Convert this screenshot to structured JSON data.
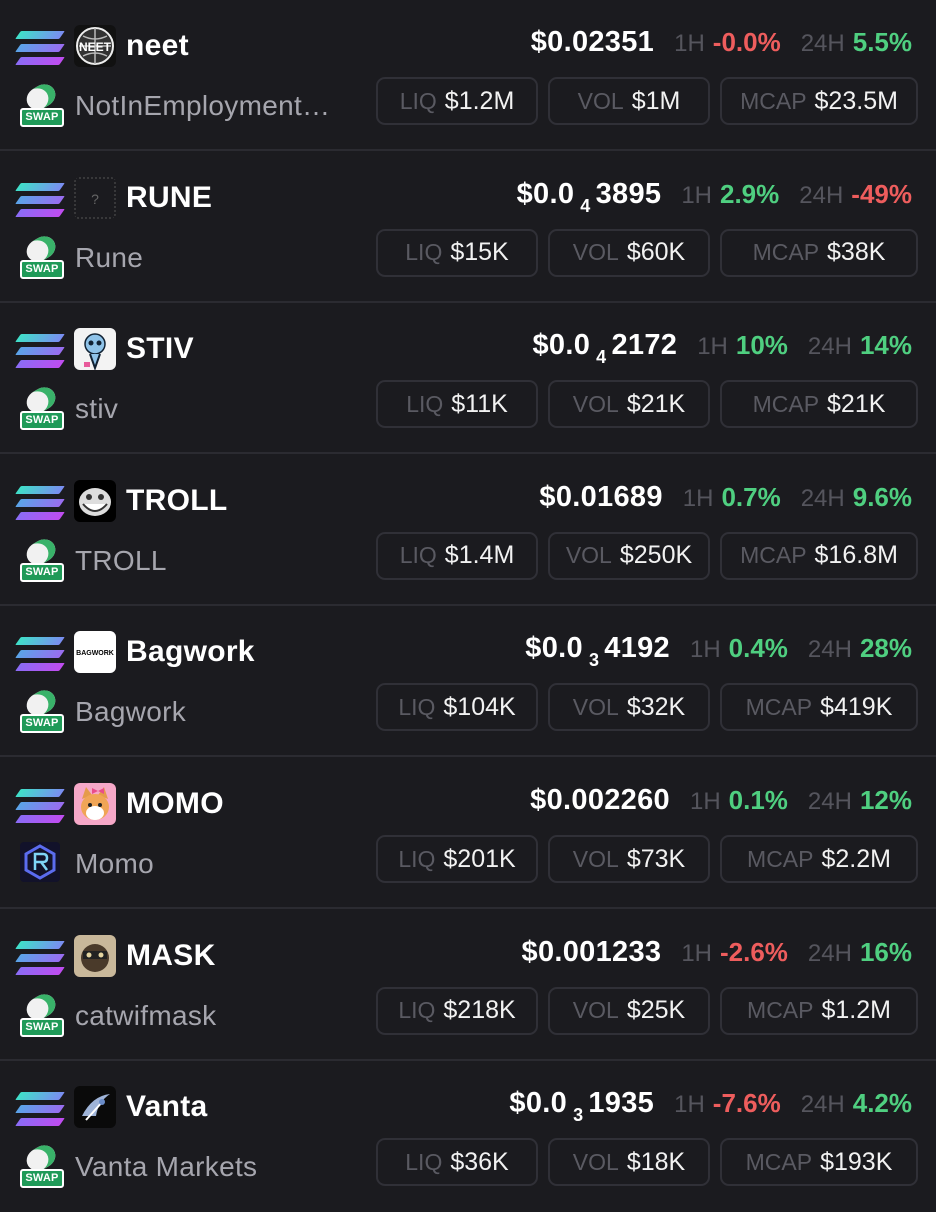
{
  "labels": {
    "liq": "LIQ",
    "vol": "VOL",
    "mcap": "MCAP",
    "h1": "1H",
    "h24": "24H",
    "swap": "SWAP"
  },
  "tokens": [
    {
      "symbol": "neet",
      "name": "NotInEmployment…",
      "price": "$0.02351",
      "price_sub": "",
      "price_tail": "",
      "change_1h": "-0.0%",
      "change_24h": "5.5%",
      "liq": "$1.2M",
      "vol": "$1M",
      "mcap": "$23.5M",
      "dex": "swap",
      "avatar_text": "NEET",
      "up1h": false,
      "up24h": true
    },
    {
      "symbol": "RUNE",
      "name": "Rune",
      "price": "$0.0",
      "price_sub": "4",
      "price_tail": "3895",
      "change_1h": "2.9%",
      "change_24h": "-49%",
      "liq": "$15K",
      "vol": "$60K",
      "mcap": "$38K",
      "dex": "swap",
      "avatar_text": "?",
      "up1h": true,
      "up24h": false
    },
    {
      "symbol": "STIV",
      "name": "stiv",
      "price": "$0.0",
      "price_sub": "4",
      "price_tail": "2172",
      "change_1h": "10%",
      "change_24h": "14%",
      "liq": "$11K",
      "vol": "$21K",
      "mcap": "$21K",
      "dex": "swap",
      "avatar_text": "",
      "up1h": true,
      "up24h": true
    },
    {
      "symbol": "TROLL",
      "name": "TROLL",
      "price": "$0.01689",
      "price_sub": "",
      "price_tail": "",
      "change_1h": "0.7%",
      "change_24h": "9.6%",
      "liq": "$1.4M",
      "vol": "$250K",
      "mcap": "$16.8M",
      "dex": "swap",
      "avatar_text": "",
      "up1h": true,
      "up24h": true
    },
    {
      "symbol": "Bagwork",
      "name": "Bagwork",
      "price": "$0.0",
      "price_sub": "3",
      "price_tail": "4192",
      "change_1h": "0.4%",
      "change_24h": "28%",
      "liq": "$104K",
      "vol": "$32K",
      "mcap": "$419K",
      "dex": "swap",
      "avatar_text": "BAGWORK",
      "up1h": true,
      "up24h": true
    },
    {
      "symbol": "MOMO",
      "name": "Momo",
      "price": "$0.002260",
      "price_sub": "",
      "price_tail": "",
      "change_1h": "0.1%",
      "change_24h": "12%",
      "liq": "$201K",
      "vol": "$73K",
      "mcap": "$2.2M",
      "dex": "raydium",
      "avatar_text": "",
      "up1h": true,
      "up24h": true
    },
    {
      "symbol": "MASK",
      "name": "catwifmask",
      "price": "$0.001233",
      "price_sub": "",
      "price_tail": "",
      "change_1h": "-2.6%",
      "change_24h": "16%",
      "liq": "$218K",
      "vol": "$25K",
      "mcap": "$1.2M",
      "dex": "swap",
      "avatar_text": "",
      "up1h": false,
      "up24h": true
    },
    {
      "symbol": "Vanta",
      "name": "Vanta Markets",
      "price": "$0.0",
      "price_sub": "3",
      "price_tail": "1935",
      "change_1h": "-7.6%",
      "change_24h": "4.2%",
      "liq": "$36K",
      "vol": "$18K",
      "mcap": "$193K",
      "dex": "swap",
      "avatar_text": "",
      "up1h": false,
      "up24h": true
    }
  ],
  "colors": {
    "background": "#1b1b1f",
    "positive": "#4fcf80",
    "negative": "#ee5d5d",
    "muted": "#a6a6ae"
  },
  "icons": {
    "chain": "solana-icon",
    "swap": "jupiter-swap-icon",
    "raydium": "raydium-icon"
  }
}
